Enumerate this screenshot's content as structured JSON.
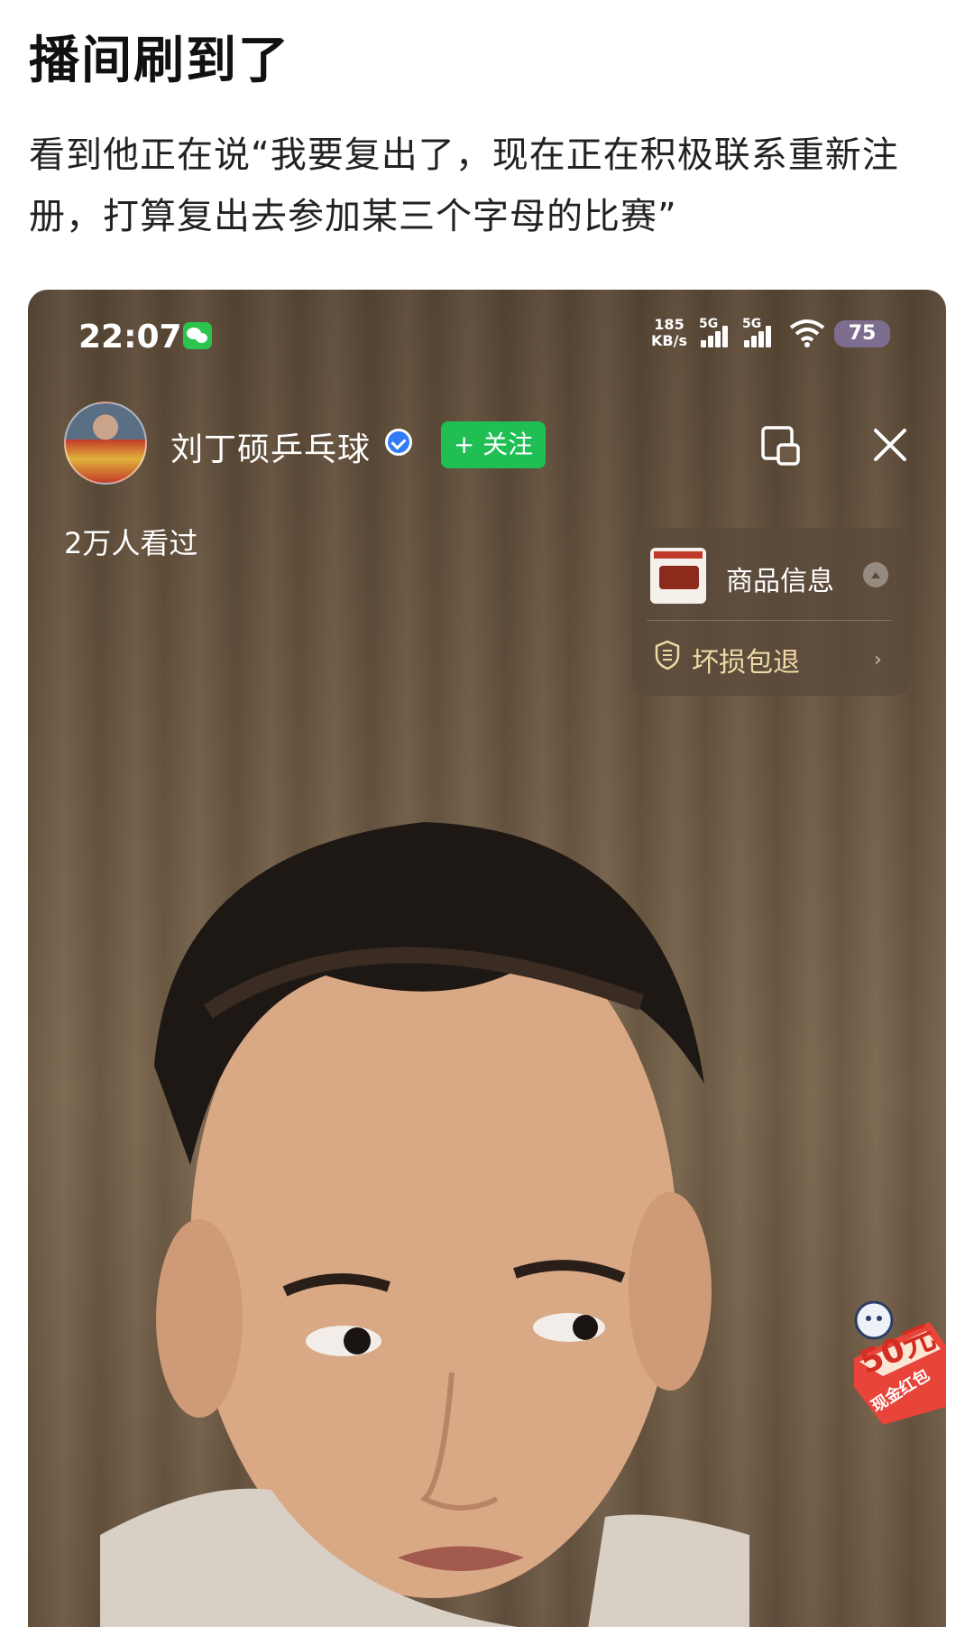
{
  "post": {
    "title": "播间刷到了",
    "body": "看到他正在说“我要复出了，现在正在积极联系重新注册，打算复出去参加某三个字母的比赛”"
  },
  "status_bar": {
    "time": "22:07",
    "net_speed_value": "185",
    "net_speed_unit": "KB/s",
    "signal_1": "5G",
    "signal_2": "5G",
    "battery": "75"
  },
  "live": {
    "streamer_name": "刘丁硕乒乓球",
    "follow_label": "+ 关注",
    "viewers": "2万人看过"
  },
  "product_card": {
    "label": "商品信息",
    "guarantee": "坏损包退",
    "chevron": "›"
  },
  "redpacket": {
    "amount": "50元",
    "label": "现金红包"
  },
  "colors": {
    "follow_green": "#1fbf54",
    "verified_blue": "#2f7cf6",
    "wechat_green": "#2bc44e",
    "redpacket_red": "#d42d21"
  }
}
